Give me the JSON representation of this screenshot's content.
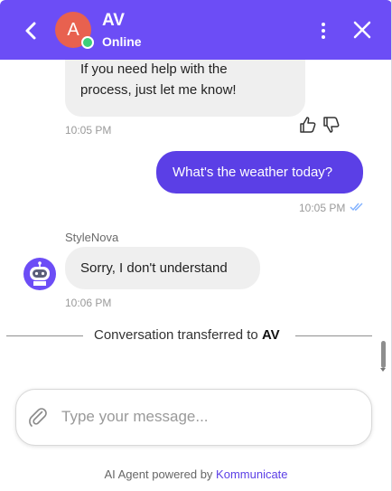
{
  "header": {
    "avatar_initial": "A",
    "agent_name": "AV",
    "status": "Online",
    "back_icon": "chevron-left-icon",
    "more_icon": "vertical-dots-icon",
    "close_icon": "close-icon",
    "background": "#6c4df6",
    "avatar_color": "#e8614f",
    "presence_color": "#3ccf7a"
  },
  "messages": [
    {
      "type": "received",
      "text_partial": "…",
      "line1": "If you need help with the",
      "line2": "process, just let me know!",
      "time": "10:05 PM",
      "feedback": [
        "thumbs-up-icon",
        "thumbs-down-icon"
      ]
    },
    {
      "type": "sent",
      "text": "What's the weather today?",
      "time": "10:05 PM",
      "status_icon": "double-check-icon"
    },
    {
      "type": "received",
      "sender": "StyleNova",
      "text": "Sorry, I don't understand",
      "time": "10:06 PM",
      "avatar_icon": "bot-icon"
    }
  ],
  "divider": {
    "prefix": "Conversation transferred to ",
    "name": "AV"
  },
  "composer": {
    "placeholder": "Type your message...",
    "value": "",
    "attach_icon": "paperclip-icon"
  },
  "footer": {
    "prefix": "AI Agent powered by ",
    "brand": "Kommunicate"
  },
  "colors": {
    "sent_bubble": "#5b3fe6",
    "received_bubble": "#efefef",
    "accent": "#6c4df6",
    "read_tick": "#7fb0ff"
  }
}
